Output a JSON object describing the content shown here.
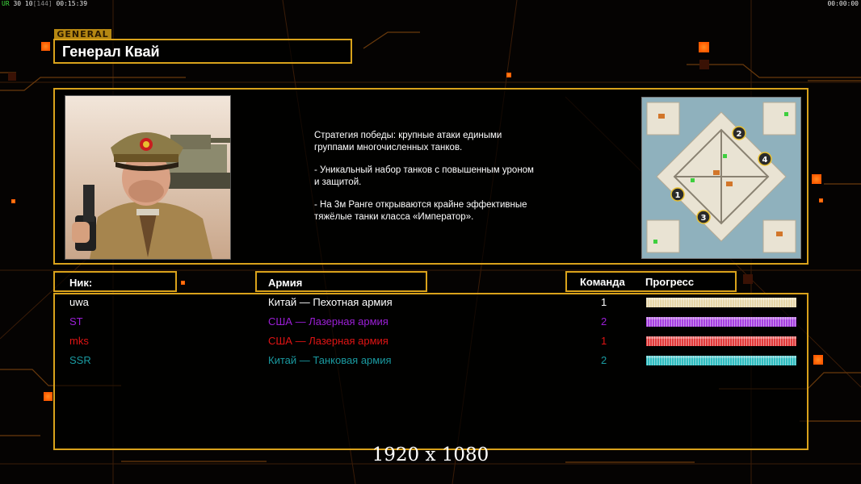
{
  "hud": {
    "fps_label": "UR",
    "fps_values": "30 10",
    "fps_bracket": "[144]",
    "elapsed": "00:15:39",
    "clock": "00:00:00"
  },
  "general": {
    "tag": "GENERAL",
    "name": "Генерал Квай",
    "portrait_icon": "general-portrait",
    "map_icon": "minimap",
    "description": [
      "Стратегия победы: крупные атаки едиными\n группами многочисленных танков.",
      "- Уникальный набор танков с повышенным уроном\n и защитой.",
      "- На 3м Ранге открываются крайне эффективные\n тяжёлые танки класса «Император»."
    ],
    "map_markers": [
      "1",
      "2",
      "3",
      "4"
    ]
  },
  "table": {
    "headers": {
      "nick": "Ник:",
      "army": "Армия",
      "team": "Команда",
      "progress": "Прогресс"
    },
    "players": [
      {
        "nick": "uwa",
        "army": "Китай — Пехотная армия",
        "team": "1",
        "progress": 1.0,
        "color": "#ffffff",
        "bar_color": "#e6d6a8"
      },
      {
        "nick": "ST",
        "army": "США — Лазерная армия",
        "team": "2",
        "progress": 1.0,
        "color": "#9b1fd6",
        "bar_color": "#a640e0"
      },
      {
        "nick": "mks",
        "army": "США — Лазерная армия",
        "team": "1",
        "progress": 1.0,
        "color": "#e01414",
        "bar_color": "#e23a3a"
      },
      {
        "nick": "SSR",
        "army": "Китай — Танковая армия",
        "team": "2",
        "progress": 1.0,
        "color": "#1a9aa0",
        "bar_color": "#2fbcc0"
      }
    ]
  },
  "footer": {
    "resolution": "1920 x 1080"
  },
  "colors": {
    "gold": "#d9a21b",
    "accent_orange": "#ff7a10",
    "background": "#050302"
  }
}
